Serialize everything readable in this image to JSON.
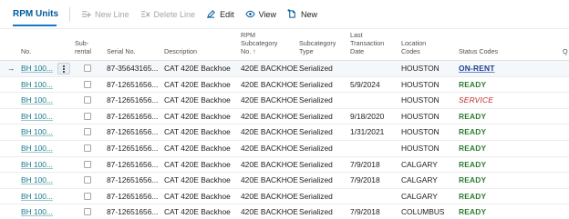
{
  "toolbar": {
    "title": "RPM Units",
    "actions": [
      {
        "label": "New Line",
        "icon": "new-line-icon",
        "enabled": false
      },
      {
        "label": "Delete Line",
        "icon": "delete-line-icon",
        "enabled": false
      },
      {
        "label": "Edit",
        "icon": "pencil-icon",
        "enabled": true
      },
      {
        "label": "View",
        "icon": "eye-icon",
        "enabled": true
      },
      {
        "label": "New",
        "icon": "new-icon",
        "enabled": true
      }
    ]
  },
  "columns": {
    "no": "No.",
    "subrental": [
      "Sub-",
      "rental"
    ],
    "serial": "Serial No.",
    "description": "Description",
    "rpm_subcategory": [
      "RPM",
      "Subcategory",
      "No. ↑"
    ],
    "subcategory_type": [
      "Subcategory",
      "Type"
    ],
    "last_transaction": [
      "Last",
      "Transaction",
      "Date"
    ],
    "location": [
      "Location",
      "Codes"
    ],
    "status": "Status Codes",
    "q": "Q"
  },
  "rows": [
    {
      "no": "BH 100...",
      "serial": "87-35643165...",
      "description": "CAT 420E Backhoe",
      "rpm": "420E BACKHOE",
      "type": "Serialized",
      "date": "",
      "location": "HOUSTON",
      "status": "ON-RENT",
      "status_kind": "rent",
      "selected": true
    },
    {
      "no": "BH 100...",
      "serial": "87-12651656...",
      "description": "CAT 420E Backhoe",
      "rpm": "420E BACKHOE",
      "type": "Serialized",
      "date": "5/9/2024",
      "location": "HOUSTON",
      "status": "READY",
      "status_kind": "ready"
    },
    {
      "no": "BH 100...",
      "serial": "87-12651656...",
      "description": "CAT 420E Backhoe",
      "rpm": "420E BACKHOE",
      "type": "Serialized",
      "date": "",
      "location": "HOUSTON",
      "status": "SERVICE",
      "status_kind": "service"
    },
    {
      "no": "BH 100...",
      "serial": "87-12651656...",
      "description": "CAT 420E Backhoe",
      "rpm": "420E BACKHOE",
      "type": "Serialized",
      "date": "9/18/2020",
      "location": "HOUSTON",
      "status": "READY",
      "status_kind": "ready"
    },
    {
      "no": "BH 100...",
      "serial": "87-12651656...",
      "description": "CAT 420E Backhoe",
      "rpm": "420E BACKHOE",
      "type": "Serialized",
      "date": "1/31/2021",
      "location": "HOUSTON",
      "status": "READY",
      "status_kind": "ready"
    },
    {
      "no": "BH 100...",
      "serial": "87-12651656...",
      "description": "CAT 420E Backhoe",
      "rpm": "420E BACKHOE",
      "type": "Serialized",
      "date": "",
      "location": "HOUSTON",
      "status": "READY",
      "status_kind": "ready"
    },
    {
      "no": "BH 100...",
      "serial": "87-12651656...",
      "description": "CAT 420E Backhoe",
      "rpm": "420E BACKHOE",
      "type": "Serialized",
      "date": "7/9/2018",
      "location": "CALGARY",
      "status": "READY",
      "status_kind": "ready"
    },
    {
      "no": "BH 100...",
      "serial": "87-12651656...",
      "description": "CAT 420E Backhoe",
      "rpm": "420E BACKHOE",
      "type": "Serialized",
      "date": "7/9/2018",
      "location": "CALGARY",
      "status": "READY",
      "status_kind": "ready"
    },
    {
      "no": "BH 100...",
      "serial": "87-12651656...",
      "description": "CAT 420E Backhoe",
      "rpm": "420E BACKHOE",
      "type": "Serialized",
      "date": "",
      "location": "CALGARY",
      "status": "READY",
      "status_kind": "ready"
    },
    {
      "no": "BH 100...",
      "serial": "87-12651656...",
      "description": "CAT 420E Backhoe",
      "rpm": "420E BACKHOE",
      "type": "Serialized",
      "date": "7/9/2018",
      "location": "COLUMBUS",
      "status": "READY",
      "status_kind": "ready"
    }
  ]
}
